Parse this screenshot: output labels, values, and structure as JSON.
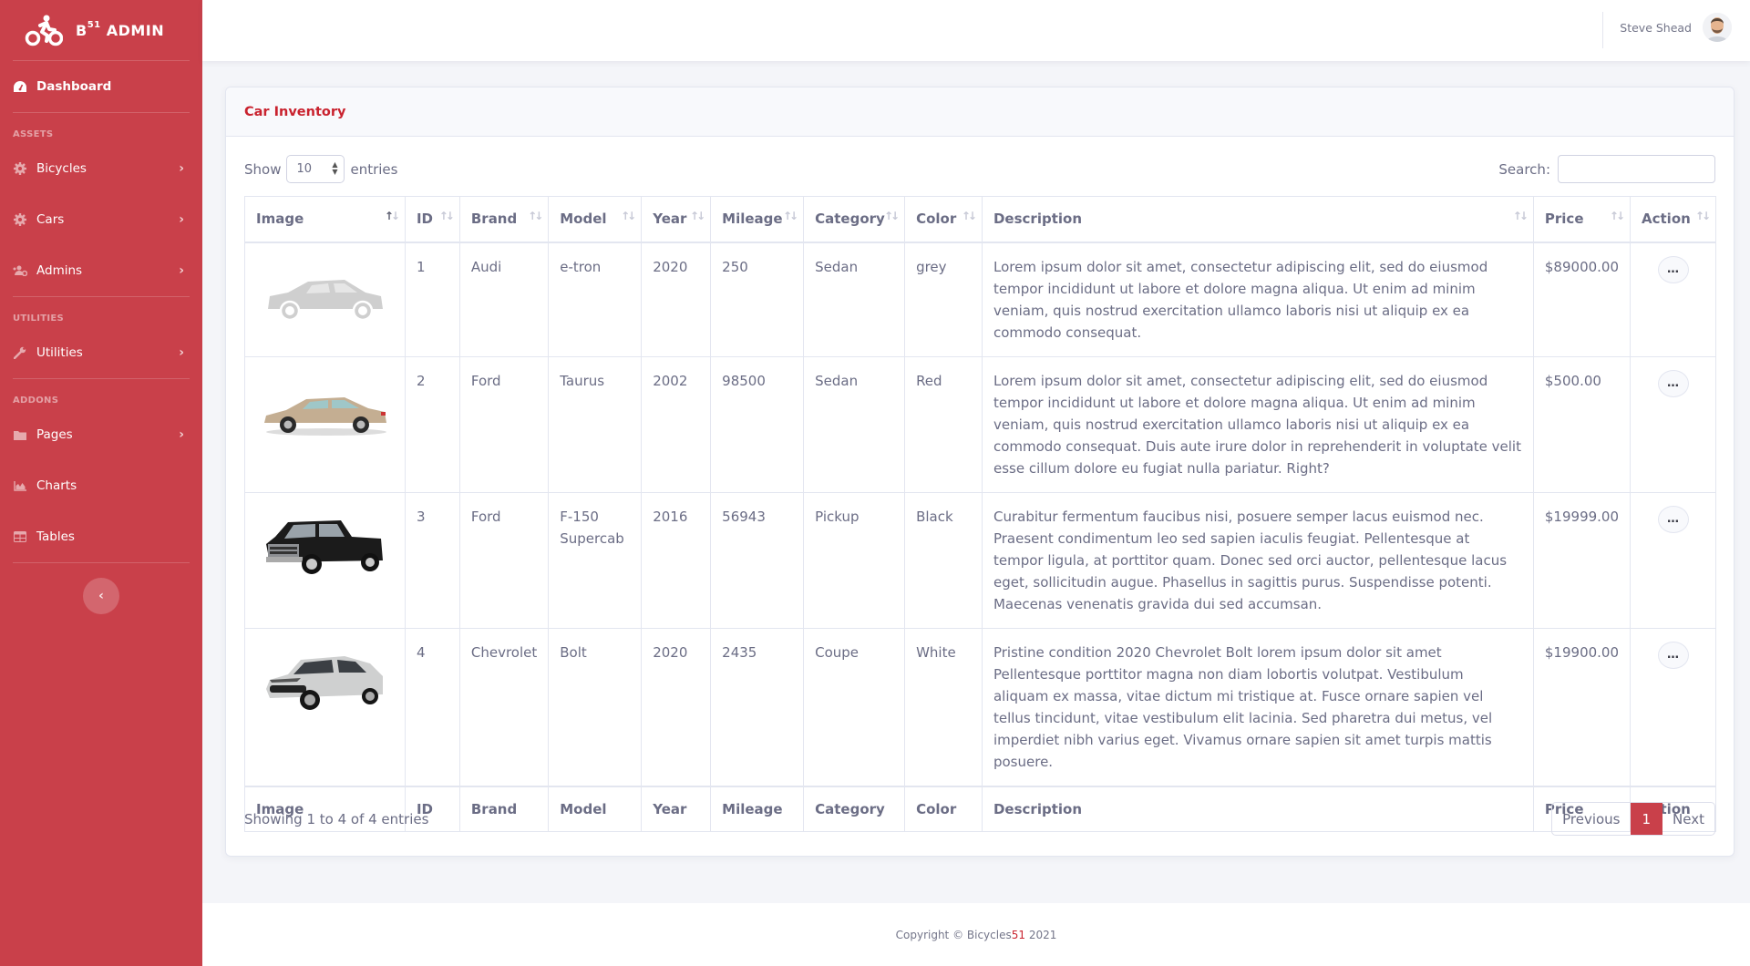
{
  "brand": {
    "name_prefix": "B",
    "name_sup": "51",
    "name_suffix": "ADMIN"
  },
  "sidebar": {
    "dashboard": {
      "label": "Dashboard",
      "icon": "tachometer-icon"
    },
    "sections": [
      {
        "heading": "ASSETS",
        "items": [
          {
            "label": "Bicycles",
            "icon": "gear-icon",
            "has_chevron": true
          },
          {
            "label": "Cars",
            "icon": "gear-icon",
            "has_chevron": true
          },
          {
            "label": "Admins",
            "icon": "users-gear-icon",
            "has_chevron": true
          }
        ]
      },
      {
        "heading": "UTILITIES",
        "items": [
          {
            "label": "Utilities",
            "icon": "wrench-icon",
            "has_chevron": true
          }
        ]
      },
      {
        "heading": "ADDONS",
        "items": [
          {
            "label": "Pages",
            "icon": "folder-icon",
            "has_chevron": true
          },
          {
            "label": "Charts",
            "icon": "area-chart-icon",
            "has_chevron": false
          },
          {
            "label": "Tables",
            "icon": "table-icon",
            "has_chevron": false
          }
        ]
      }
    ],
    "toggle_icon": "chevron-left-icon"
  },
  "topbar": {
    "user_name": "Steve Shead"
  },
  "card": {
    "title": "Car Inventory"
  },
  "table_controls": {
    "show_label": "Show",
    "entries_label": "entries",
    "page_length": "10",
    "page_length_options": [
      "10"
    ],
    "search_label": "Search:",
    "search_value": ""
  },
  "table": {
    "columns": [
      "Image",
      "ID",
      "Brand",
      "Model",
      "Year",
      "Mileage",
      "Category",
      "Color",
      "Description",
      "Price",
      "Action"
    ],
    "sorted_column": "Image",
    "sort_direction": "ascending",
    "rows": [
      {
        "image": "silver sedan placeholder",
        "id": "1",
        "brand": "Audi",
        "model": "e-tron",
        "year": "2020",
        "mileage": "250",
        "category": "Sedan",
        "color": "grey",
        "description": "Lorem ipsum dolor sit amet, consectetur adipiscing elit, sed do eiusmod tempor incididunt ut labore et dolore magna aliqua. Ut enim ad minim veniam, quis nostrud exercitation ullamco laboris nisi ut aliquip ex ea commodo consequat.",
        "price": "$89000.00",
        "action": "…"
      },
      {
        "image": "tan sedan",
        "id": "2",
        "brand": "Ford",
        "model": "Taurus",
        "year": "2002",
        "mileage": "98500",
        "category": "Sedan",
        "color": "Red",
        "description": "Lorem ipsum dolor sit amet, consectetur adipiscing elit, sed do eiusmod tempor incididunt ut labore et dolore magna aliqua. Ut enim ad minim veniam, quis nostrud exercitation ullamco laboris nisi ut aliquip ex ea commodo consequat. Duis aute irure dolor in reprehenderit in voluptate velit esse cillum dolore eu fugiat nulla pariatur. Right?",
        "price": "$500.00",
        "action": "…"
      },
      {
        "image": "black pickup truck",
        "id": "3",
        "brand": "Ford",
        "model": "F-150 Supercab",
        "year": "2016",
        "mileage": "56943",
        "category": "Pickup",
        "color": "Black",
        "description": "Curabitur fermentum faucibus nisi, posuere semper lacus euismod nec. Praesent condimentum leo sed sapien iaculis feugiat. Pellentesque at tempor ligula, at porttitor quam. Donec sed orci auctor, pellentesque lacus eget, sollicitudin augue. Phasellus in sagittis purus. Suspendisse potenti. Maecenas venenatis gravida dui sed accumsan.",
        "price": "$19999.00",
        "action": "…"
      },
      {
        "image": "silver hatchback",
        "id": "4",
        "brand": "Chevrolet",
        "model": "Bolt",
        "year": "2020",
        "mileage": "2435",
        "category": "Coupe",
        "color": "White",
        "description": "Pristine condition 2020 Chevrolet Bolt lorem ipsum dolor sit amet Pellentesque porttitor magna non diam lobortis volutpat. Vestibulum aliquam ex massa, vitae dictum mi tristique at. Fusce ornare sapien vel tellus tincidunt, vitae vestibulum elit lacinia. Sed pharetra dui metus, vel imperdiet nibh varius eget. Vivamus ornare sapien sit amet turpis mattis posuere.",
        "price": "$19900.00",
        "action": "…"
      }
    ]
  },
  "pagination": {
    "info": "Showing 1 to 4 of 4 entries",
    "previous": "Previous",
    "current": "1",
    "next": "Next"
  },
  "footer": {
    "prefix": "Copyright © Bicycles",
    "highlight": "51",
    "suffix": " 2021"
  },
  "colors": {
    "primary": "#c9404a",
    "title_red": "#c9222e",
    "text": "#6b6d85",
    "background": "#f4f5f9"
  }
}
